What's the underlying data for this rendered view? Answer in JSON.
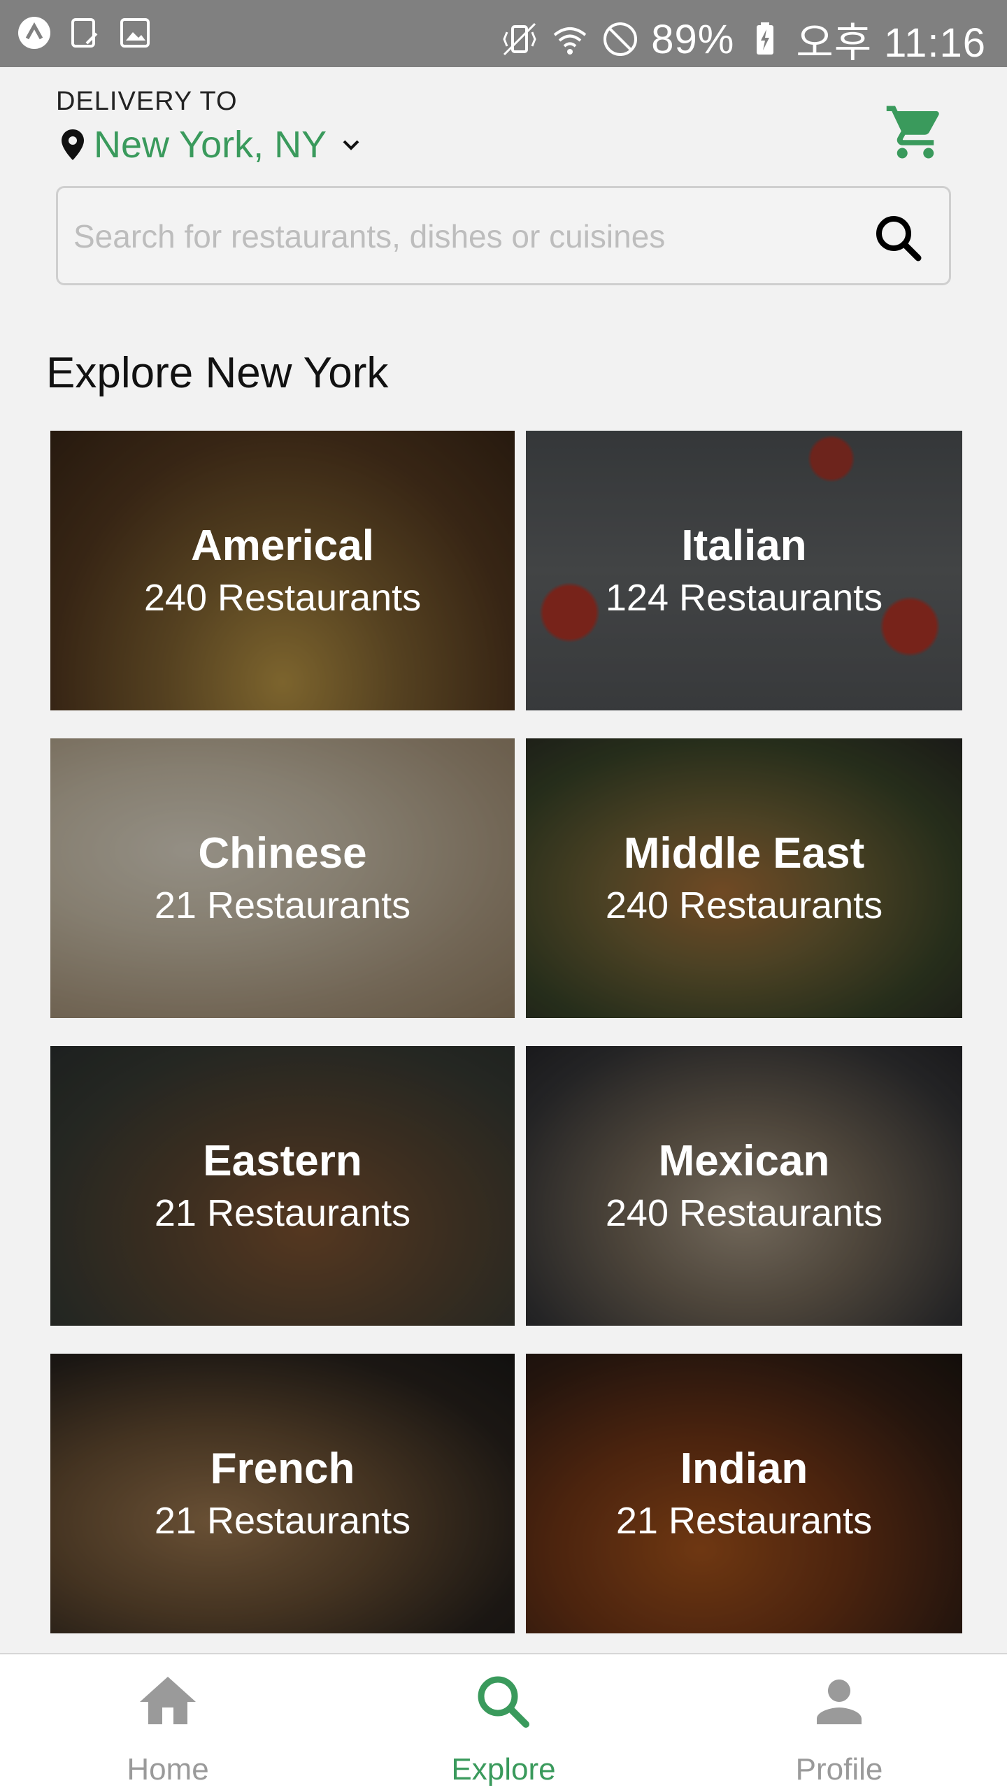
{
  "status_bar": {
    "battery": "89%",
    "time": "오후 11:16",
    "icons": [
      "app-icon",
      "screenshot-icon",
      "gallery-icon",
      "vibrate-icon",
      "wifi-icon",
      "do-not-disturb-icon",
      "battery-charging-icon"
    ]
  },
  "header": {
    "delivery_label": "DELIVERY TO",
    "location": "New York, NY",
    "location_icon": "pin-icon",
    "cart_icon": "cart-icon"
  },
  "search": {
    "placeholder": "Search for restaurants, dishes or cuisines",
    "value": ""
  },
  "section_title": "Explore New York",
  "cuisines": [
    {
      "name": "Americal",
      "count": "240 Restaurants"
    },
    {
      "name": "Italian",
      "count": "124 Restaurants"
    },
    {
      "name": "Chinese",
      "count": "21 Restaurants"
    },
    {
      "name": "Middle East",
      "count": "240 Restaurants"
    },
    {
      "name": "Eastern",
      "count": "21 Restaurants"
    },
    {
      "name": "Mexican",
      "count": "240 Restaurants"
    },
    {
      "name": "French",
      "count": "21 Restaurants"
    },
    {
      "name": "Indian",
      "count": "21 Restaurants"
    }
  ],
  "bottom_nav": {
    "items": [
      {
        "label": "Home",
        "icon": "home-icon"
      },
      {
        "label": "Explore",
        "icon": "search-icon",
        "active": true
      },
      {
        "label": "Profile",
        "icon": "person-icon"
      }
    ]
  },
  "colors": {
    "accent": "#3a9a5c",
    "status_bar": "#808080",
    "inactive": "#9a9a9a"
  }
}
